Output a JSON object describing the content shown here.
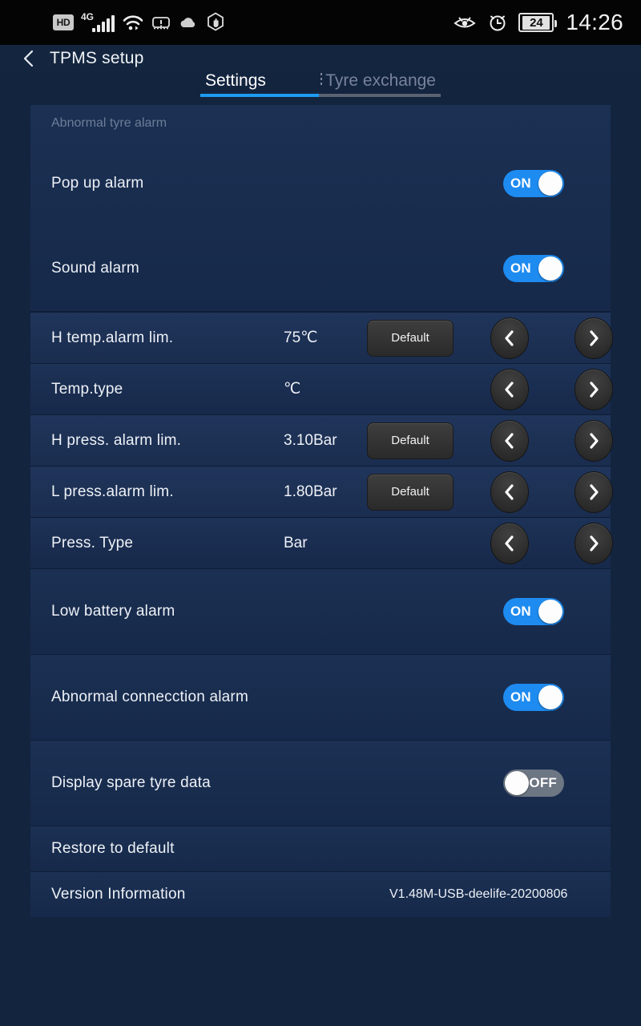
{
  "statusbar": {
    "hd_label": "HD",
    "network_label": "4G",
    "signal_icon": "signal-bars-icon",
    "wifi_icon": "wifi-icon",
    "tpms_warning_icon": "tpms-warning-icon",
    "cloud_icon": "cloud-icon",
    "hand_stop_icon": "hand-stop-icon",
    "eye_care_icon": "eye-care-icon",
    "alarm_icon": "alarm-clock-icon",
    "battery_level": "24",
    "time": "14:26"
  },
  "titlebar": {
    "back_icon": "back-chevron-icon",
    "title": "TPMS setup"
  },
  "tabs": {
    "active_index": 0,
    "items": [
      {
        "label": "Settings"
      },
      {
        "label": "Tyre exchange"
      }
    ]
  },
  "sections": {
    "abnormal_tyre_alarm": {
      "header": "Abnormal tyre alarm",
      "rows": [
        {
          "label": "Pop up alarm",
          "toggle": "ON"
        },
        {
          "label": "Sound alarm",
          "toggle": "ON"
        }
      ]
    },
    "steppers": [
      {
        "label": "H temp.alarm lim.",
        "value": "75℃",
        "default_label": "Default",
        "has_default": true
      },
      {
        "label": "Temp.type",
        "value": "℃",
        "default_label": "",
        "has_default": false
      },
      {
        "label": "H press. alarm lim.",
        "value": "3.10Bar",
        "default_label": "Default",
        "has_default": true
      },
      {
        "label": "L press.alarm lim.",
        "value": "1.80Bar",
        "default_label": "Default",
        "has_default": true
      },
      {
        "label": "Press. Type",
        "value": "Bar",
        "default_label": "",
        "has_default": false
      }
    ],
    "toggles": [
      {
        "label": "Low battery alarm",
        "toggle": "ON"
      },
      {
        "label": "Abnormal connecction alarm",
        "toggle": "ON"
      },
      {
        "label": "Display spare tyre data",
        "toggle": "OFF"
      }
    ],
    "footer": {
      "restore_label": "Restore to default",
      "version_label": "Version Information",
      "version_value": "V1.48M-USB-deelife-20200806"
    }
  },
  "icons": {
    "arrow_left": "chevron-left-icon",
    "arrow_right": "chevron-right-icon"
  },
  "colors": {
    "accent": "#1e8bf0",
    "panel": "#16294a",
    "page_background": "#13243f",
    "statusbar_background": "#040404",
    "toggle_off": "#6d7683"
  }
}
